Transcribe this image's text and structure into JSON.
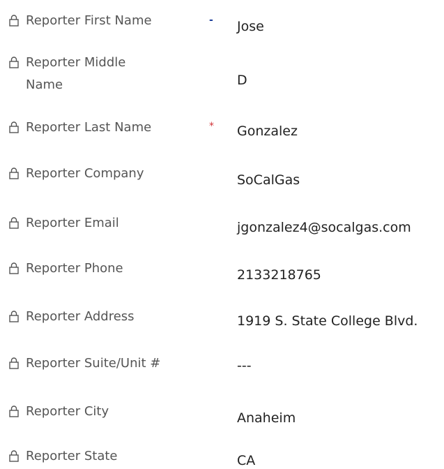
{
  "fields": [
    {
      "label": "Reporter First Name",
      "value": "Jose",
      "required_marker": "-"
    },
    {
      "label": "Reporter Middle Name",
      "value": "D"
    },
    {
      "label": "Reporter Last Name",
      "value": "Gonzalez",
      "required_marker": "*"
    },
    {
      "label": "Reporter Company",
      "value": "SoCalGas"
    },
    {
      "label": "Reporter Email",
      "value": "jgonzalez4@socalgas.com"
    },
    {
      "label": "Reporter Phone",
      "value": "2133218765"
    },
    {
      "label": "Reporter Address",
      "value": "1919 S. State College Blvd."
    },
    {
      "label": "Reporter Suite/Unit #",
      "value": "---"
    },
    {
      "label": "Reporter City",
      "value": "Anaheim"
    },
    {
      "label": "Reporter State",
      "value": "CA"
    }
  ],
  "colors": {
    "label": "#555555",
    "value": "#222222",
    "required_optional": "#1d3f9a",
    "required_mandatory": "#d13438"
  },
  "icons": {
    "field_lock": "lock-icon"
  }
}
